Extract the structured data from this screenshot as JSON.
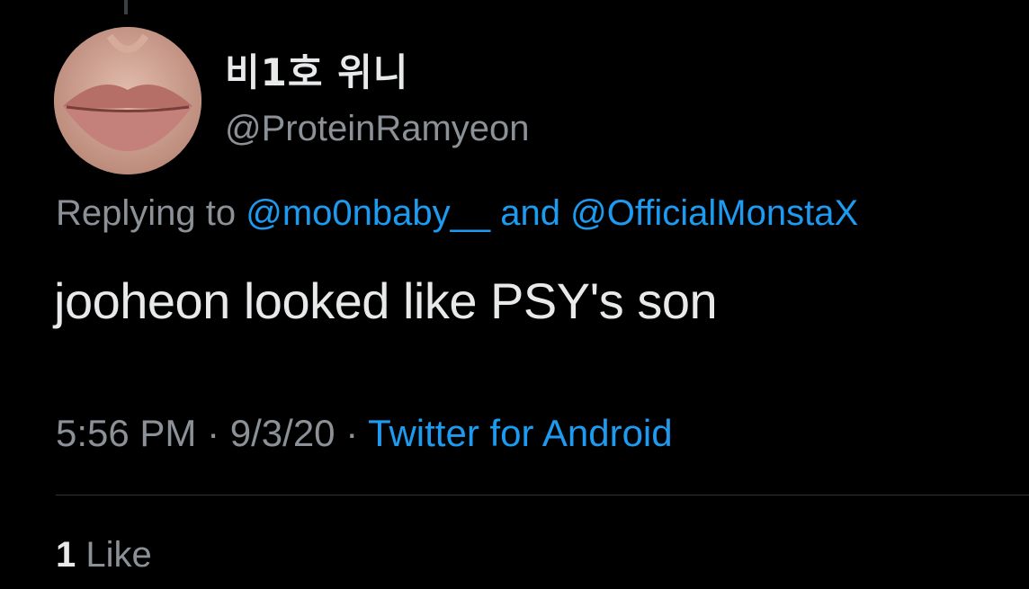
{
  "tweet": {
    "author": {
      "display_name": "비1호 위니",
      "handle": "@ProteinRamyeon",
      "avatar_icon": "avatar-photo-icon"
    },
    "reply": {
      "prefix": "Replying to",
      "user1": "@mo0nbaby__",
      "conjunction": "and",
      "user2": "@OfficialMonstaX"
    },
    "text": "jooheon looked like PSY's son",
    "meta": {
      "time": "5:56 PM",
      "separator": "·",
      "date": "9/3/20",
      "source": "Twitter for Android"
    },
    "likes": {
      "count": "1",
      "label": "Like"
    }
  },
  "colors": {
    "background": "#000000",
    "link": "#1d9bf0",
    "secondary_text": "#8b9196",
    "primary_text": "#e7e9ea"
  }
}
